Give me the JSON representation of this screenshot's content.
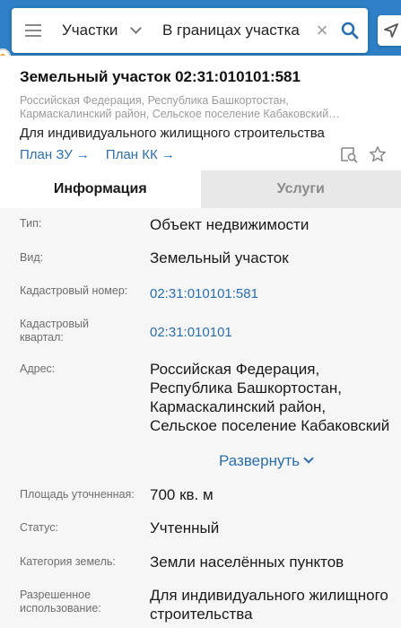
{
  "search": {
    "layer": "Участки",
    "query": "В границах участка"
  },
  "card": {
    "title": "Земельный участок 02:31:010101:581",
    "address_short": "Российская Федерация, Республика Башкортостан, Кармаскалинский район, Сельское поселение Кабаковский…",
    "purpose": "Для индивидуального жилищного строительства",
    "plan_zu": "План ЗУ →",
    "plan_kk": "План КК →"
  },
  "tabs": {
    "info": "Информация",
    "services": "Услуги"
  },
  "props": {
    "type_label": "Тип:",
    "type_value": "Объект недвижимости",
    "kind_label": "Вид:",
    "kind_value": "Земельный участок",
    "cadnum_label": "Кадастровый номер:",
    "cadnum_value": "02:31:010101:581",
    "quarter_label": "Кадастровый квартал:",
    "quarter_value": "02:31:010101",
    "address_label": "Адрес:",
    "address_value": "Российская Федерация, Республика Башкортостан, Кармаскалинский район, Сельское поселение Кабаковский сельсовет,",
    "expand": "Развернуть",
    "area_label": "Площадь уточненная:",
    "area_value": "700 кв. м",
    "status_label": "Статус:",
    "status_value": "Учтенный",
    "category_label": "Категория земель:",
    "category_value": "Земли населённых пунктов",
    "permitted_label": "Разрешенное использование:",
    "permitted_value": "Для индивидуального жилищного строительства"
  },
  "colors": {
    "map_blue": "#2d80c5",
    "link": "#2a6fb0",
    "panel_bg": "#f6f6f6"
  }
}
